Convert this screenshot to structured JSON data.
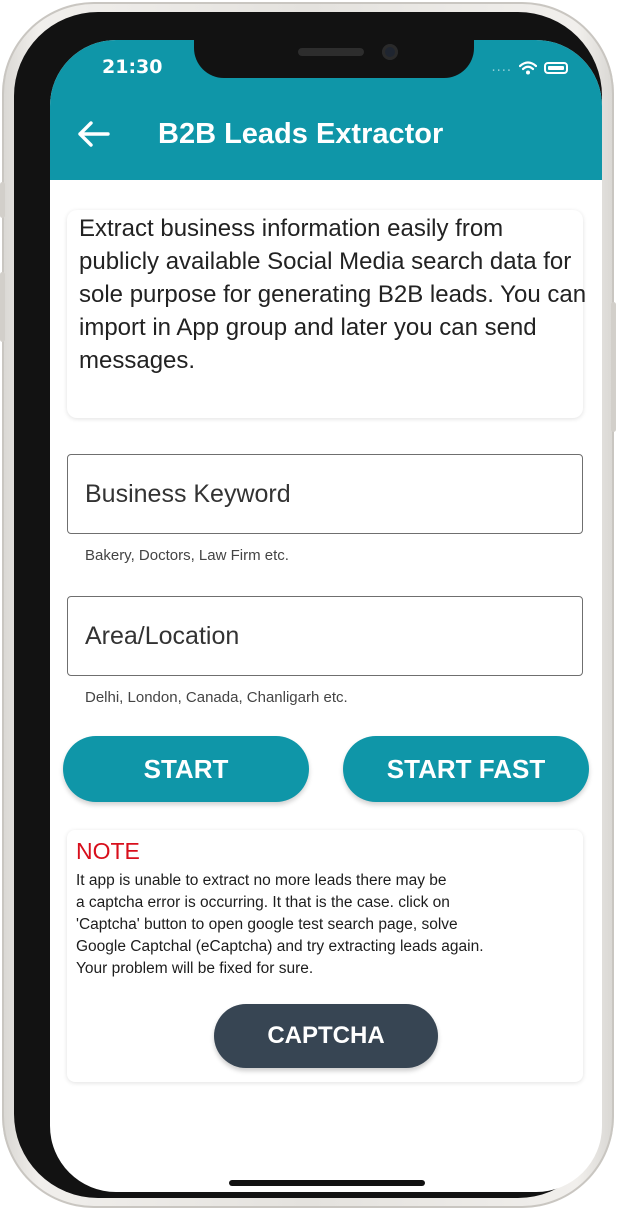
{
  "status_bar": {
    "time": "21:30",
    "signal": "....",
    "icons": [
      "wifi-icon",
      "battery-icon"
    ]
  },
  "header": {
    "title": "B2B Leads Extractor",
    "back_icon": "arrow-left-icon",
    "color": "#0f96a8"
  },
  "intro": {
    "text": "Extract business information easily from publicly available Social Media search data for sole purpose for generating B2B leads. You can import in App group and later you can send messages."
  },
  "form": {
    "keyword_label": "Business Keyword",
    "keyword_helper": "Bakery, Doctors, Law Firm etc.",
    "location_label": "Area/Location",
    "location_helper": "Delhi, London, Canada, Chanligarh etc."
  },
  "buttons": {
    "start": "START",
    "start_fast": "START FAST",
    "color": "#0f96a8"
  },
  "note": {
    "title": "NOTE",
    "lines": [
      "It app is unable to extract no more leads there may be",
      "a captcha error is occurring. It that is the case. click on",
      "'Captcha' button to open google test search page, solve",
      "Google Captchal (eCaptcha) and try extracting leads again.",
      "Your problem will be fixed for sure."
    ],
    "captcha_button": "CAPTCHA",
    "title_color": "#d80f1c",
    "captcha_color": "#374553"
  }
}
